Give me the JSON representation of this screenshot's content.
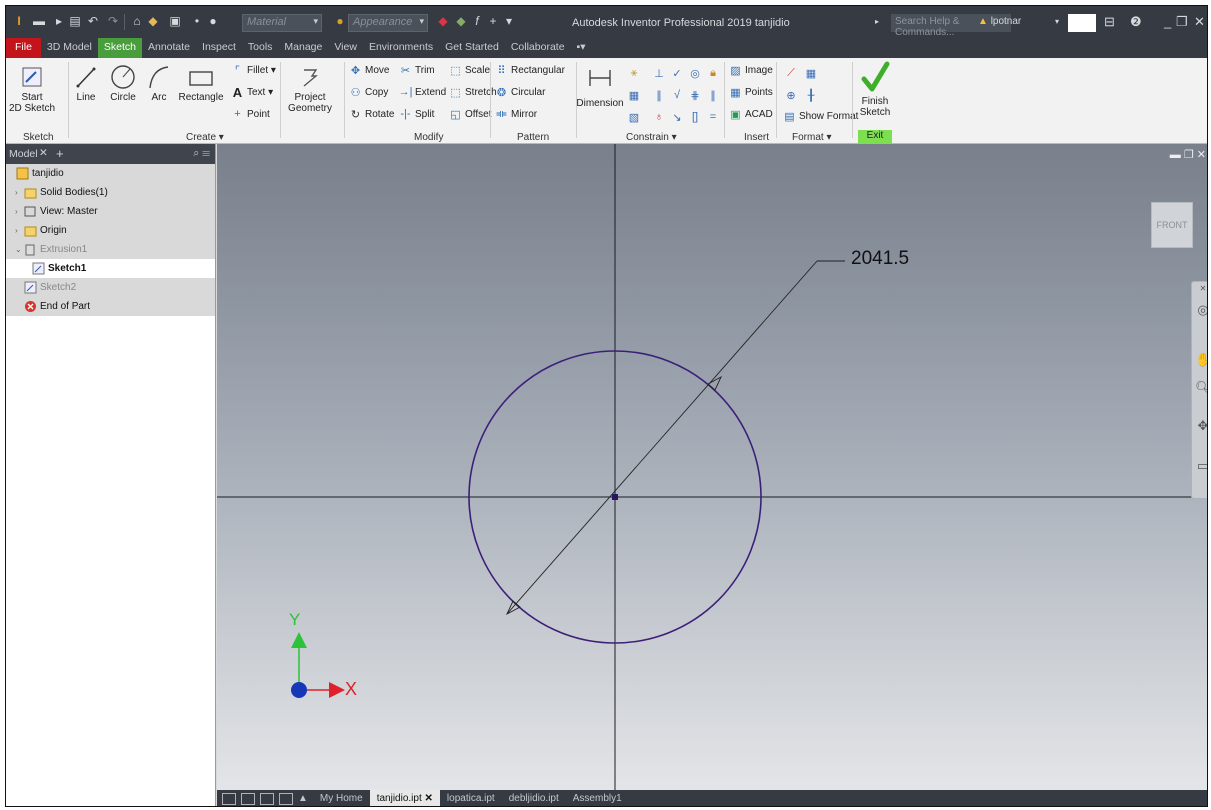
{
  "titlebar": {
    "app_title": "Autodesk Inventor Professional 2019  tanjidio",
    "material_placeholder": "Material",
    "appearance_placeholder": "Appearance",
    "search_placeholder": "Search Help & Commands...",
    "user_name": "lpotnar"
  },
  "menu_tabs": [
    "File",
    "3D Model",
    "Sketch",
    "Annotate",
    "Inspect",
    "Tools",
    "Manage",
    "View",
    "Environments",
    "Get Started",
    "Collaborate"
  ],
  "ribbon": {
    "start_sketch": "Start\n2D Sketch",
    "line": "Line",
    "circle": "Circle",
    "arc": "Arc",
    "rectangle": "Rectangle",
    "fillet": "Fillet",
    "text": "Text",
    "point": "Point",
    "project_geometry": "Project\nGeometry",
    "move": "Move",
    "trim": "Trim",
    "scale": "Scale",
    "copy": "Copy",
    "extend": "Extend",
    "stretch": "Stretch",
    "rotate": "Rotate",
    "split": "Split",
    "offset": "Offset",
    "rectangular": "Rectangular",
    "circular": "Circular",
    "mirror": "Mirror",
    "dimension": "Dimension",
    "image": "Image",
    "points": "Points",
    "acad": "ACAD",
    "show_format": "Show Format",
    "finish_sketch": "Finish\nSketch",
    "groups": {
      "sketch": "Sketch",
      "create": "Create ▾",
      "modify": "Modify",
      "pattern": "Pattern",
      "constrain": "Constrain ▾",
      "insert": "Insert",
      "format": "Format ▾",
      "exit": "Exit"
    }
  },
  "browser": {
    "tab": "Model",
    "tree": [
      {
        "label": "tanjidio",
        "indent": 0,
        "twist": "",
        "icon": "part",
        "state": "normal"
      },
      {
        "label": "Solid Bodies(1)",
        "indent": 1,
        "twist": ">",
        "icon": "folder",
        "state": "normal"
      },
      {
        "label": "View: Master",
        "indent": 1,
        "twist": ">",
        "icon": "view",
        "state": "normal"
      },
      {
        "label": "Origin",
        "indent": 1,
        "twist": ">",
        "icon": "folder",
        "state": "normal"
      },
      {
        "label": "Extrusion1",
        "indent": 1,
        "twist": "v",
        "icon": "extrude",
        "state": "dim"
      },
      {
        "label": "Sketch1",
        "indent": 2,
        "twist": "",
        "icon": "sketch",
        "state": "selected"
      },
      {
        "label": "Sketch2",
        "indent": 1,
        "twist": "",
        "icon": "sketch",
        "state": "dim"
      },
      {
        "label": "End of Part",
        "indent": 1,
        "twist": "",
        "icon": "end",
        "state": "normal"
      }
    ]
  },
  "viewport": {
    "dimension_value": "2041.5",
    "viewcube_label": "FRONT",
    "axis_x": "X",
    "axis_y": "Y"
  },
  "doc_tabs": [
    "My Home",
    "tanjidio.ipt",
    "lopatica.ipt",
    "debljidio.ipt",
    "Assembly1"
  ],
  "active_doc": "tanjidio.ipt"
}
